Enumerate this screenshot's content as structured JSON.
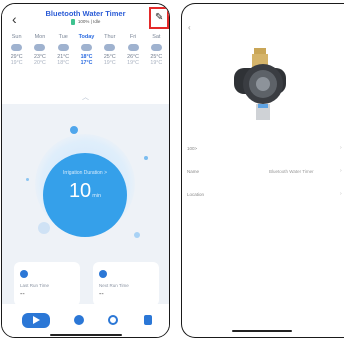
{
  "header": {
    "title": "Bluetooth Water Timer",
    "battery": "100%",
    "status": "Idle"
  },
  "forecast": [
    {
      "day": "Sun",
      "high": "29°C",
      "low": "19°C"
    },
    {
      "day": "Mon",
      "high": "23°C",
      "low": "20°C"
    },
    {
      "day": "Tue",
      "high": "21°C",
      "low": "18°C"
    },
    {
      "day": "Today",
      "high": "18°C",
      "low": "17°C"
    },
    {
      "day": "Thur",
      "high": "25°C",
      "low": "19°C"
    },
    {
      "day": "Fri",
      "high": "26°C",
      "low": "19°C"
    },
    {
      "day": "Sat",
      "high": "25°C",
      "low": "19°C"
    }
  ],
  "duration": {
    "label": "Irrigation Duration >",
    "value": "10",
    "unit": "min"
  },
  "cards": {
    "last_label": "Last Run Time",
    "last_value": "--",
    "next_label": "Next Run Time",
    "next_value": "--"
  },
  "details": {
    "rows": [
      {
        "key": "100>",
        "value": ""
      },
      {
        "key": "Name",
        "value": "Bluetooth Water Timer"
      },
      {
        "key": "Location",
        "value": ""
      }
    ]
  },
  "colors": {
    "accent": "#2b77d6",
    "ring": "#35a0ea",
    "title": "#2b5cd6",
    "highlight": "#e32a2a"
  },
  "icons": {
    "back": "chevron-left-icon",
    "edit": "pencil-icon",
    "play": "play-icon",
    "clock": "alarm-clock-icon",
    "log": "document-icon"
  }
}
